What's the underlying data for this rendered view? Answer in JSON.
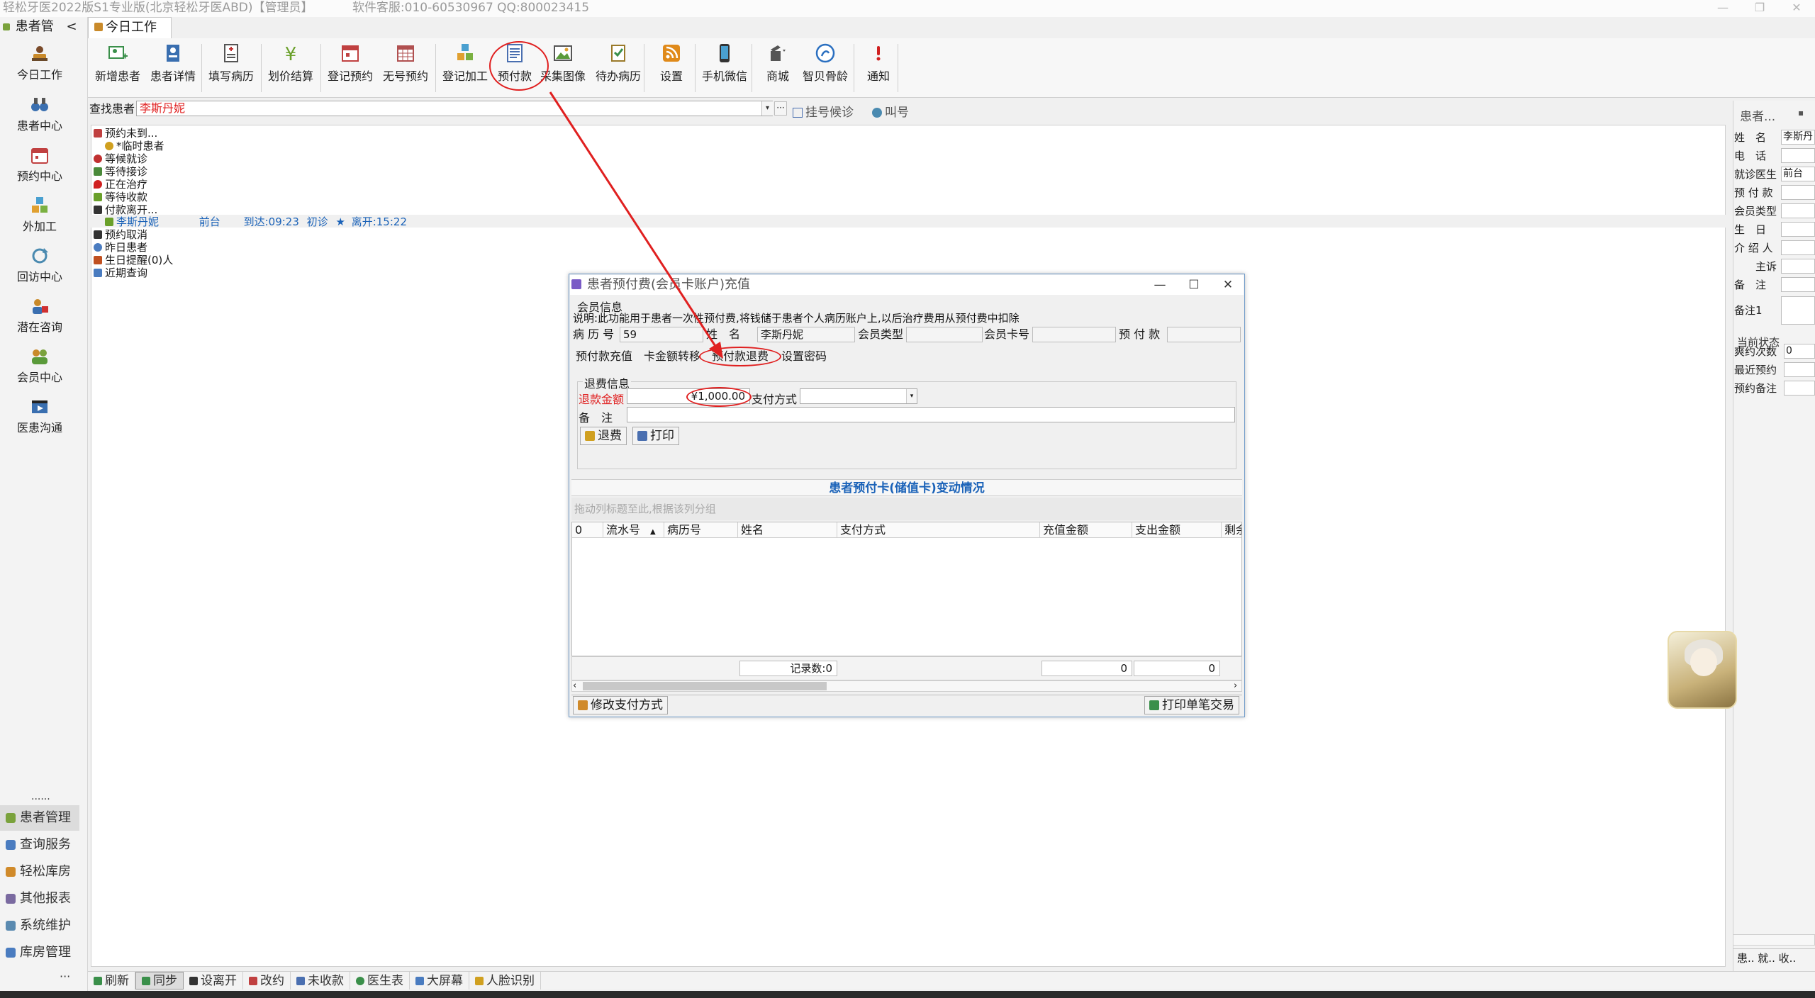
{
  "window": {
    "title": "轻松牙医2022版S1专业版(北京轻松牙医ABD)【管理员】",
    "hotline": "软件客服:010-60530967 QQ:800023415",
    "controls": [
      "—",
      "❐",
      "✕"
    ]
  },
  "sidebar": {
    "header": "患者管",
    "collapse_glyph": "<",
    "items": [
      {
        "label": "今日工作",
        "icon": "person-desk-icon"
      },
      {
        "label": "患者中心",
        "icon": "binoculars-icon"
      },
      {
        "label": "预约中心",
        "icon": "calendar-icon"
      },
      {
        "label": "外加工",
        "icon": "cubes-icon"
      },
      {
        "label": "回访中心",
        "icon": "refresh-icon"
      },
      {
        "label": "潜在咨询",
        "icon": "consult-icon"
      },
      {
        "label": "会员中心",
        "icon": "members-icon"
      },
      {
        "label": "医患沟通",
        "icon": "film-icon"
      }
    ],
    "dots": "......",
    "bottom": [
      {
        "label": "患者管理",
        "selected": true,
        "color": "#7aa23c"
      },
      {
        "label": "查询服务",
        "selected": false,
        "color": "#4a7cc0"
      },
      {
        "label": "轻松库房",
        "selected": false,
        "color": "#d08a2a"
      },
      {
        "label": "其他报表",
        "selected": false,
        "color": "#7a6aa0"
      },
      {
        "label": "系统维护",
        "selected": false,
        "color": "#5a8ab0"
      },
      {
        "label": "库房管理",
        "selected": false,
        "color": "#4a7cc0"
      }
    ],
    "more": "···"
  },
  "tab": {
    "label": "今日工作"
  },
  "toolbar": {
    "buttons": [
      {
        "label": "新增患者",
        "icon": "add-patient-icon",
        "color": "#3a8f4a"
      },
      {
        "label": "患者详情",
        "icon": "patient-card-icon",
        "color": "#3a6fb0"
      },
      {
        "label": "填写病历",
        "icon": "medical-record-icon",
        "color": "#c03030"
      },
      {
        "label": "划价结算",
        "icon": "yuan-icon",
        "color": "#6aa02a"
      },
      {
        "label": "登记预约",
        "icon": "calendar-red-icon",
        "color": "#c04040"
      },
      {
        "label": "无号预约",
        "icon": "calendar-grid-icon",
        "color": "#b05050"
      },
      {
        "label": "登记加工",
        "icon": "cubes-icon",
        "color": "#d08a2a"
      },
      {
        "label": "预付款",
        "icon": "prepay-icon",
        "color": "#4a6fb0"
      },
      {
        "label": "采集图像",
        "icon": "image-icon",
        "color": "#5a9a3a"
      },
      {
        "label": "待办病历",
        "icon": "todo-record-icon",
        "color": "#9a7a2a"
      },
      {
        "label": "设置",
        "icon": "rss-icon",
        "color": "#e08a1a"
      },
      {
        "label": "手机微信",
        "icon": "phone-icon",
        "color": "#333333"
      },
      {
        "label": "商城",
        "icon": "shop-icon",
        "color": "#555555"
      },
      {
        "label": "智贝骨龄",
        "icon": "bone-age-icon",
        "color": "#2a6fc0"
      },
      {
        "label": "通知",
        "icon": "alert-icon",
        "color": "#d02020"
      }
    ]
  },
  "search": {
    "label": "查找患者",
    "value": "李斯丹妮",
    "dropdown_glyph": "▾",
    "more_glyph": "···",
    "queue_label": "挂号候诊",
    "call_label": "叫号"
  },
  "tree": {
    "rows": [
      {
        "text": "预约未到...",
        "indent": 0,
        "color": "#c04040"
      },
      {
        "text": "*临时患者",
        "indent": 1,
        "color": "#d0a020"
      },
      {
        "text": "等候就诊",
        "indent": 0,
        "color": "#c03030"
      },
      {
        "text": "等待接诊",
        "indent": 0,
        "color": "#4a8a3a"
      },
      {
        "text": "正在治疗",
        "indent": 0,
        "color": "#d02020"
      },
      {
        "text": "等待收款",
        "indent": 0,
        "color": "#6aa02a"
      },
      {
        "text": "付款离开...",
        "indent": 0,
        "color": "#333333"
      },
      {
        "text": "预约取消",
        "indent": 0,
        "color": "#333333"
      },
      {
        "text": "昨日患者",
        "indent": 0,
        "color": "#4a7cc0"
      },
      {
        "text": "生日提醒(0)人",
        "indent": 0,
        "color": "#c05020"
      },
      {
        "text": "近期查询",
        "indent": 0,
        "color": "#4a7cc0"
      }
    ],
    "patient": {
      "name": "李斯丹妮",
      "doctor": "前台",
      "arrive": "到达:09:23",
      "visit": "初诊",
      "star": "★",
      "leave": "离开:15:22"
    }
  },
  "right_panel": {
    "title": "患者...",
    "pin": "▪",
    "fields": [
      {
        "label": "姓　名",
        "value": "李斯丹"
      },
      {
        "label": "电　话",
        "value": ""
      },
      {
        "label": "就诊医生",
        "value": "前台"
      },
      {
        "label": "预 付 款",
        "value": ""
      },
      {
        "label": "会员类型",
        "value": ""
      },
      {
        "label": "生　日",
        "value": ""
      },
      {
        "label": "介 绍 人",
        "value": ""
      },
      {
        "label": "主诉",
        "value": ""
      },
      {
        "label": "备　注",
        "value": ""
      },
      {
        "label": "备注1",
        "value": ""
      }
    ],
    "group": "当前状态",
    "status_fields": [
      {
        "label": "爽约次数",
        "value": "0"
      },
      {
        "label": "最近预约",
        "value": ""
      },
      {
        "label": "预约备注",
        "value": ""
      }
    ],
    "tabs": "患.. 就.. 收.."
  },
  "statusbar": {
    "items": [
      {
        "label": "刷新",
        "selected": false,
        "color": "#3a8f4a"
      },
      {
        "label": "同步",
        "selected": true,
        "color": "#3a8f4a"
      },
      {
        "label": "设离开",
        "selected": false,
        "color": "#333333"
      },
      {
        "label": "改约",
        "selected": false,
        "color": "#c04040"
      },
      {
        "label": "未收款",
        "selected": false,
        "color": "#4a6fb0"
      },
      {
        "label": "医生表",
        "selected": false,
        "color": "#3a8f4a"
      },
      {
        "label": "大屏幕",
        "selected": false,
        "color": "#4a7cc0"
      },
      {
        "label": "人脸识别",
        "selected": false,
        "color": "#d0a020"
      }
    ]
  },
  "dialog": {
    "title": "患者预付费(会员卡账户)充值",
    "controls": [
      "—",
      "☐",
      "✕"
    ],
    "member_group": "会员信息",
    "description": "说明:此功能用于患者一次性预付费,将钱储于患者个人病历账户上,以后治疗费用从预付费中扣除",
    "fields": {
      "record_no_label": "病 历 号",
      "record_no": "59",
      "name_label": "姓　名",
      "name": "李斯丹妮",
      "member_type_label": "会员类型",
      "member_type": "",
      "card_no_label": "会员卡号",
      "card_no": "",
      "prepay_label": "预 付 款",
      "prepay": ""
    },
    "subtabs": [
      "预付款充值",
      "卡金额转移",
      "预付款退费",
      "设置密码"
    ],
    "refund_group": "退费信息",
    "refund_amount_label": "退款金额",
    "refund_amount": "¥1,000.00",
    "pay_method_label": "支付方式",
    "pay_method": "",
    "note_label": "备　注",
    "note": "",
    "refund_button": "退费",
    "print_button": "打印",
    "grid_title": "患者预付卡(储值卡)变动情况",
    "group_hint": "拖动列标题至此,根据该列分组",
    "columns": [
      "0",
      "流水号",
      "病历号",
      "姓名",
      "支付方式",
      "充值金额",
      "支出金额",
      "剩余"
    ],
    "sort_glyph": "▲",
    "record_count": "记录数:0",
    "sum_charge": "0",
    "sum_expense": "0",
    "scroll_left": "‹",
    "scroll_right": "›",
    "modify_pay_button": "修改支付方式",
    "print_single_button": "打印单笔交易"
  },
  "annotation": {
    "color": "#e02020"
  }
}
